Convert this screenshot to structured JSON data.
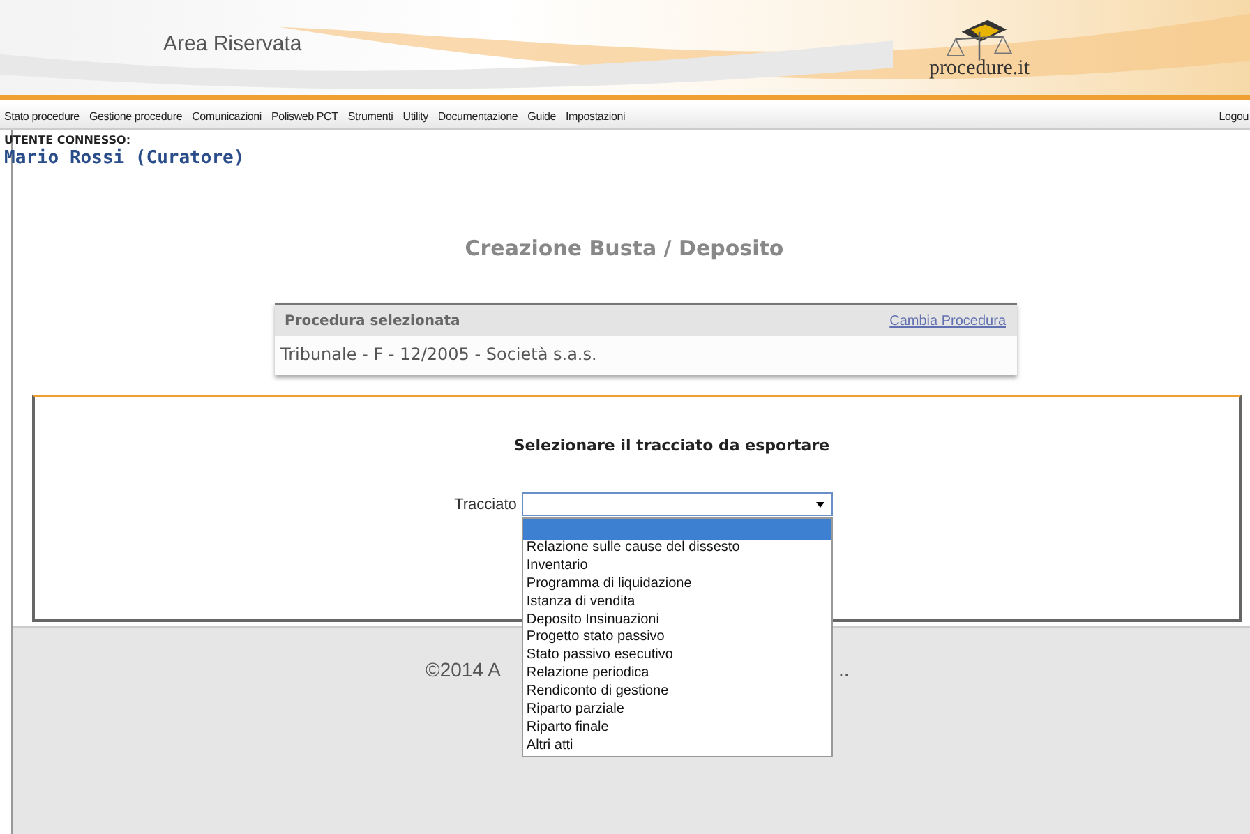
{
  "header": {
    "title": "Area Riservata",
    "logo_text": "procedure.it"
  },
  "nav": {
    "items": [
      "Stato procedure",
      "Gestione procedure",
      "Comunicazioni",
      "Polisweb PCT",
      "Strumenti",
      "Utility",
      "Documentazione",
      "Guide",
      "Impostazioni"
    ],
    "logout": "Logou"
  },
  "user": {
    "label": "UTENTE CONNESSO:",
    "name": "Mario Rossi (Curatore)"
  },
  "page_title": "Creazione Busta / Deposito",
  "procedure_box": {
    "heading": "Procedura selezionata",
    "link": "Cambia Procedura",
    "value": "Tribunale - F - 12/2005 - Società s.a.s."
  },
  "form": {
    "heading": "Selezionare il tracciato da esportare",
    "field_label": "Tracciato",
    "dropdown": {
      "open": true,
      "blank_option_selected": true,
      "options": [
        {
          "label": "Relazione sulle cause del dissesto",
          "selected": false
        },
        {
          "label": "Inventario",
          "selected": false
        },
        {
          "label": "Programma di liquidazione",
          "selected": false
        },
        {
          "label": "Istanza di vendita",
          "selected": false
        },
        {
          "label": "Deposito Insinuazioni",
          "selected": false
        },
        {
          "label": "Progetto stato passivo",
          "selected": false
        },
        {
          "label": "Stato passivo esecutivo",
          "selected": false
        },
        {
          "label": "Relazione periodica",
          "selected": false
        },
        {
          "label": "Rendiconto di gestione",
          "selected": false
        },
        {
          "label": "Riparto parziale",
          "selected": false
        },
        {
          "label": "Riparto finale",
          "selected": false
        },
        {
          "label": "Altri atti",
          "selected": false
        }
      ]
    }
  },
  "footer": {
    "text": "©2014 A",
    "tail": ".."
  }
}
